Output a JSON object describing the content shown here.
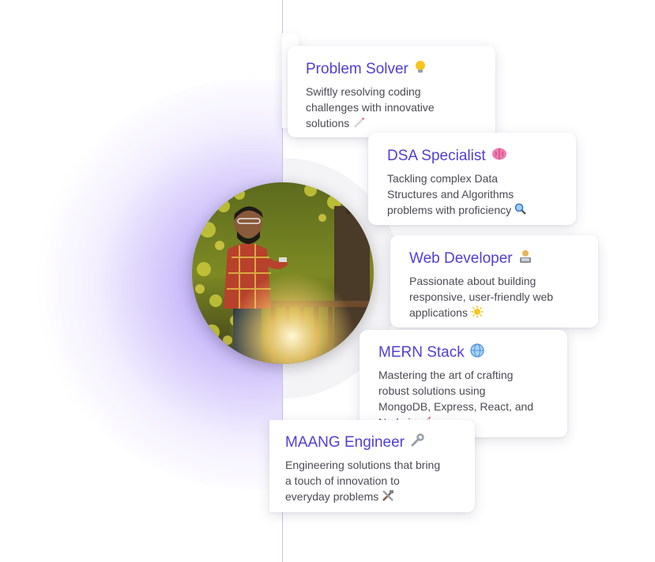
{
  "profile": {
    "photo_alt": "profile-photo"
  },
  "cards": [
    {
      "title": "Problem Solver",
      "icon": "lightbulb-icon",
      "desc_lines": [
        "Swiftly resolving coding",
        "challenges with innovative",
        "solutions"
      ],
      "desc_icon": "rocket-icon"
    },
    {
      "title": "DSA Specialist",
      "icon": "brain-icon",
      "desc_lines": [
        "Tackling complex Data",
        "Structures and Algorithms",
        "problems with proficiency"
      ],
      "desc_icon": "magnifier-icon"
    },
    {
      "title": "Web Developer",
      "icon": "technologist-icon",
      "desc_lines": [
        "Passionate about building",
        "responsive, user-friendly web",
        "applications"
      ],
      "desc_icon": "sun-icon"
    },
    {
      "title": "MERN Stack",
      "icon": "globe-icon",
      "desc_lines": [
        "Mastering the art of crafting",
        "robust solutions using",
        "MongoDB, Express, React, and",
        "Node.js"
      ],
      "desc_icon": "rocket-icon"
    },
    {
      "title": "MAANG Engineer",
      "icon": "wrench-icon",
      "desc_lines": [
        "Engineering solutions that bring",
        "a touch of innovation to",
        "everyday problems"
      ],
      "desc_icon": "tools-icon"
    }
  ]
}
